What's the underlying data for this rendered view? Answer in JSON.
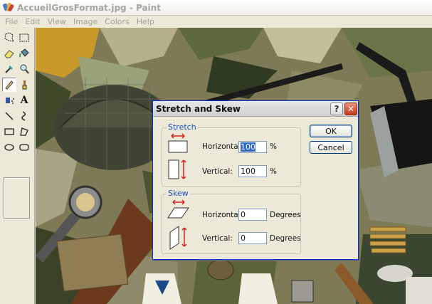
{
  "window": {
    "title": "AccueilGrosFormat.jpg - Paint",
    "app_icon": "paint-palette-icon"
  },
  "menu": [
    "File",
    "Edit",
    "View",
    "Image",
    "Colors",
    "Help"
  ],
  "tools": [
    {
      "name": "free-form-select-icon"
    },
    {
      "name": "rect-select-icon"
    },
    {
      "name": "eraser-icon"
    },
    {
      "name": "fill-bucket-icon"
    },
    {
      "name": "color-picker-icon"
    },
    {
      "name": "magnifier-icon"
    },
    {
      "name": "pencil-icon",
      "active": true
    },
    {
      "name": "brush-icon"
    },
    {
      "name": "airbrush-icon"
    },
    {
      "name": "text-icon"
    },
    {
      "name": "line-icon"
    },
    {
      "name": "curve-icon"
    },
    {
      "name": "rectangle-icon"
    },
    {
      "name": "polygon-icon"
    },
    {
      "name": "ellipse-icon"
    },
    {
      "name": "rounded-rect-icon"
    }
  ],
  "text_tool_glyph": "A",
  "dialog": {
    "title": "Stretch and Skew",
    "help_glyph": "?",
    "close_glyph": "✕",
    "stretch": {
      "label": "Stretch",
      "horizontal_label": "Horizontal:",
      "horizontal_value": "100",
      "horizontal_unit": "%",
      "vertical_label": "Vertical:",
      "vertical_value": "100",
      "vertical_unit": "%"
    },
    "skew": {
      "label": "Skew",
      "horizontal_label": "Horizontal:",
      "horizontal_value": "0",
      "horizontal_unit": "Degrees",
      "vertical_label": "Vertical:",
      "vertical_value": "0",
      "vertical_unit": "Degrees"
    },
    "ok_label": "OK",
    "cancel_label": "Cancel"
  },
  "colors": {
    "dialog_border": "#0831d9",
    "group_label": "#1b4fbf",
    "arrow_red": "#d42020"
  }
}
